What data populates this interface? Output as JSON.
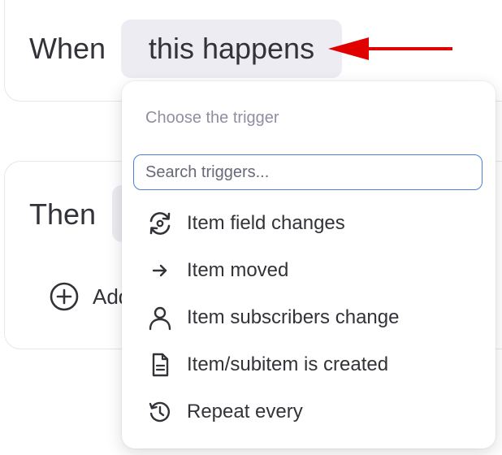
{
  "when_block": {
    "label": "When",
    "trigger_chip": "this happens"
  },
  "then_block": {
    "label": "Then",
    "add_text": "Add"
  },
  "dropdown": {
    "heading": "Choose the trigger",
    "search_placeholder": "Search triggers...",
    "items": [
      {
        "label": "Item field changes",
        "icon": "refresh-eye-icon"
      },
      {
        "label": "Item moved",
        "icon": "arrow-right-icon"
      },
      {
        "label": "Item subscribers change",
        "icon": "person-icon"
      },
      {
        "label": "Item/subitem is created",
        "icon": "document-icon"
      },
      {
        "label": "Repeat every",
        "icon": "history-icon"
      }
    ]
  },
  "colors": {
    "annotation_arrow": "#e00000",
    "search_border": "#4b7fd9",
    "chip_background": "#ececf2"
  }
}
